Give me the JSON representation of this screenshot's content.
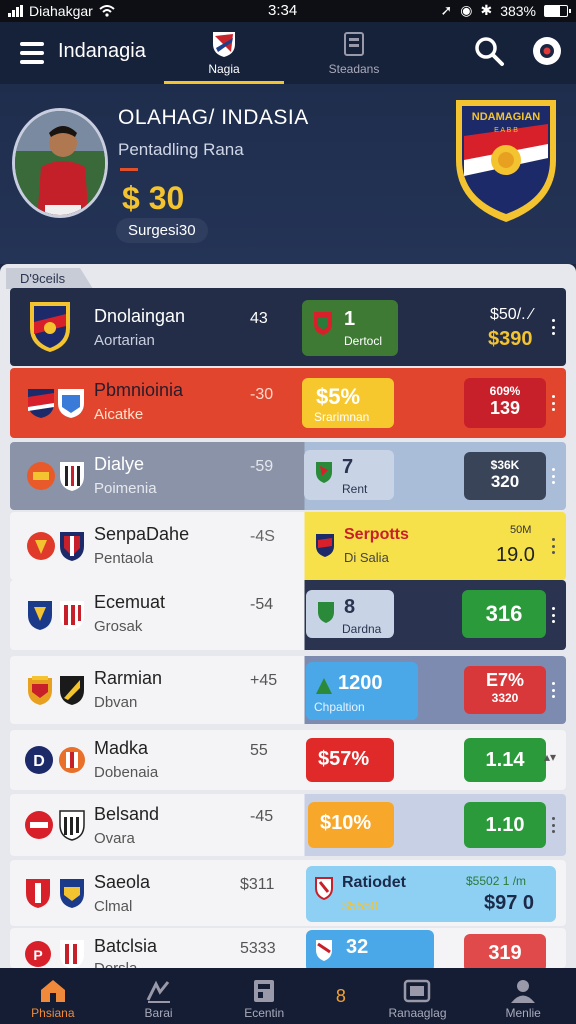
{
  "status": {
    "carrier": "Diahakgar",
    "time": "3:34",
    "battery": "383%"
  },
  "header": {
    "app_title": "Indanagia",
    "tabs": [
      {
        "label": "Nagia",
        "active": true
      },
      {
        "label": "Steadans",
        "active": false
      }
    ]
  },
  "hero": {
    "title": "OLAHAG/ INDASIA",
    "subtitle": "Pentadling Rana",
    "price": "$ 30",
    "pill": "Surgesi30",
    "crest_text_1": "NDAMAGIAN",
    "crest_text_2": "E A B B"
  },
  "list_tag": "D'9ceils",
  "rows": [
    {
      "name": "Dnolaingan",
      "sub": "Aortarian",
      "num": "43",
      "box_title": "1",
      "box_sub": "Dertocl",
      "odds_top": "$50/. ⁄",
      "odds_main": "$390"
    },
    {
      "name": "Pbmnioinia",
      "sub": "Aicatke",
      "num": "-30",
      "box_title": "$5%",
      "box_sub": "Srarimnan",
      "odds_top": "609%",
      "odds_main": "139"
    },
    {
      "name": "Dialye",
      "sub": "Poimenia",
      "num": "-59",
      "box_title": "7",
      "box_sub": "Rent",
      "odds_top": "$36K",
      "odds_main": "320"
    },
    {
      "name": "SenpaDahe",
      "sub": "Pentaola",
      "num": "-4S",
      "box_title": "Serpotts",
      "box_sub": "Di Salia",
      "odds_top": "50M",
      "odds_main": "19.0"
    },
    {
      "name": "Ecemuat",
      "sub": "Grosak",
      "num": "-54",
      "box_title": "8",
      "box_sub": "Dardna",
      "odds_top": "",
      "odds_main": "316"
    },
    {
      "name": "Rarmian",
      "sub": "Dbvan",
      "num": "+45",
      "box_title": "1200",
      "box_sub": "Chpaltion",
      "odds_top": "E7%",
      "odds_main": "3320"
    },
    {
      "name": "Madka",
      "sub": "Dobenaia",
      "num": "55",
      "box_title": "$57%",
      "box_sub": "",
      "odds_top": "",
      "odds_main": "1.14"
    },
    {
      "name": "Belsand",
      "sub": "Ovara",
      "num": "-45",
      "box_title": "$10%",
      "box_sub": "",
      "odds_top": "",
      "odds_main": "1.10"
    },
    {
      "name": "Saeola",
      "sub": "Clmal",
      "num": "$311",
      "box_title": "Ratiodet",
      "box_sub": "$5550",
      "odds_top": "$5502 1 /m",
      "odds_main": "$97 0"
    },
    {
      "name": "Batclsia",
      "sub": "Dorsla",
      "num": "5333",
      "box_title": "32",
      "box_sub": "",
      "odds_top": "",
      "odds_main": "319"
    }
  ],
  "bottom_nav": [
    {
      "label": "Phsiana",
      "icon": "home-icon",
      "active": true
    },
    {
      "label": "Barai",
      "icon": "stats-icon",
      "active": false
    },
    {
      "label": "Ecentin",
      "icon": "schedule-icon",
      "active": false,
      "badge": "8"
    },
    {
      "label": "Ranaaglag",
      "icon": "wallet-icon",
      "active": false
    },
    {
      "label": "Menlie",
      "icon": "profile-icon",
      "active": false
    }
  ]
}
